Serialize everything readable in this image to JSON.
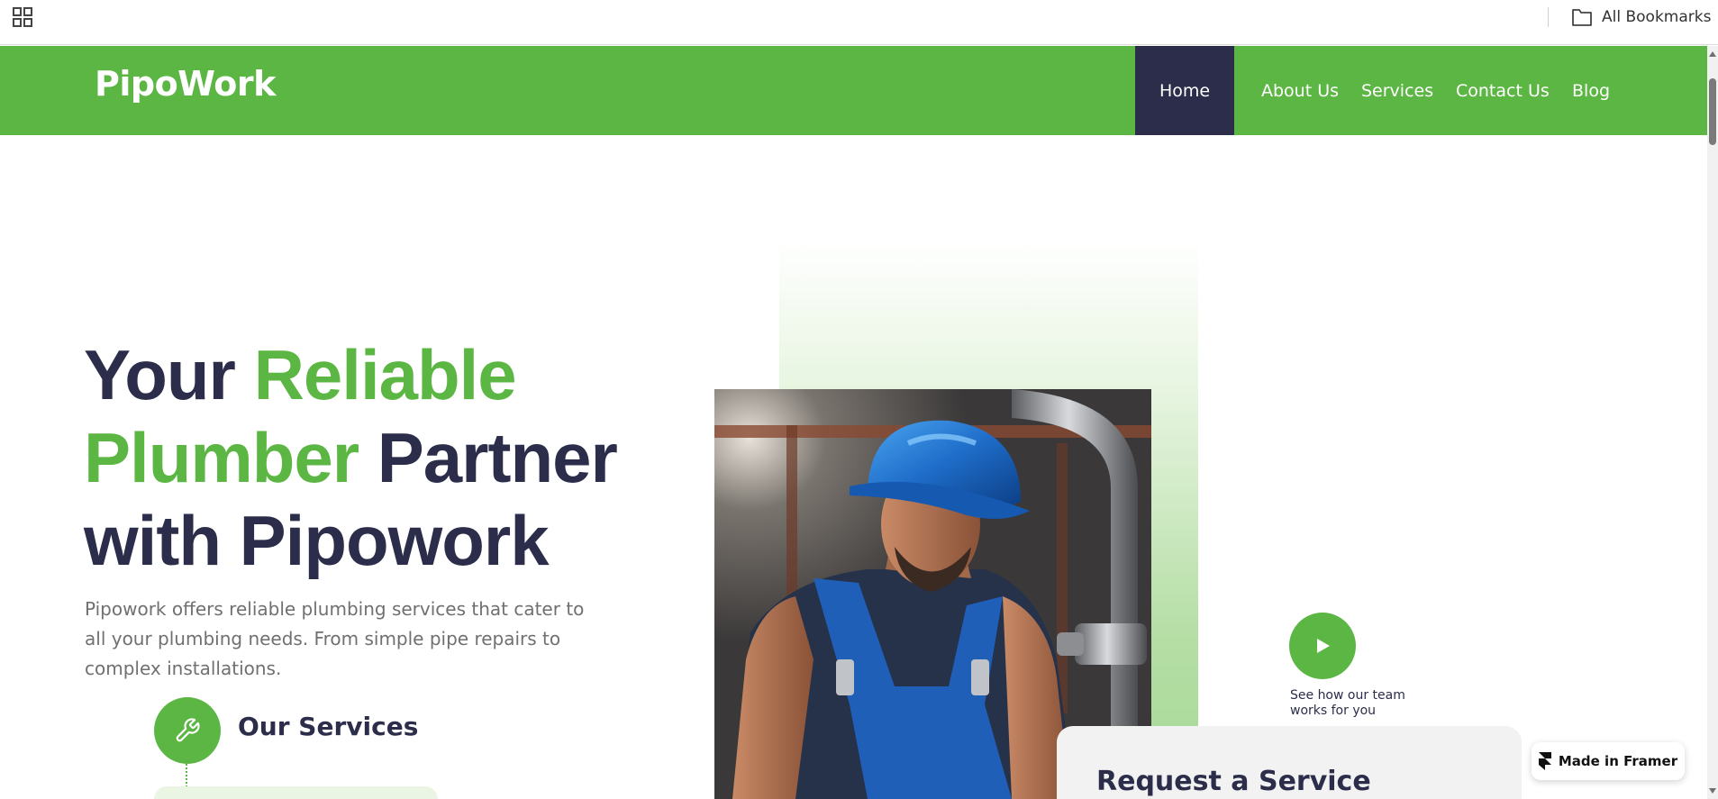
{
  "bookmarks_bar": {
    "apps_icon": "apps-grid-icon",
    "folder_icon": "folder-icon",
    "all_bookmarks_label": "All Bookmarks"
  },
  "nav": {
    "logo": "PipoWork",
    "items": [
      {
        "label": "Home",
        "active": true
      },
      {
        "label": "About Us"
      },
      {
        "label": "Services"
      },
      {
        "label": "Contact Us"
      },
      {
        "label": "Blog"
      }
    ]
  },
  "hero": {
    "title_part1": "Your ",
    "title_accent1": "Reliable",
    "title_accent2": "Plumber",
    "title_part2": " Partner",
    "title_part3": "with Pipowork",
    "description": "Pipowork offers reliable plumbing services that cater to all your plumbing needs. From simple pipe repairs to complex installations."
  },
  "services": {
    "icon": "wrench-icon",
    "title": "Our Services"
  },
  "video": {
    "icon": "play-icon",
    "caption": "See how our team works for you"
  },
  "request": {
    "title": "Request a Service"
  },
  "framer_badge": {
    "icon": "framer-icon",
    "label": "Made in Framer"
  },
  "colors": {
    "brand_green": "#5cb643",
    "navy": "#2b2d4a",
    "text_gray": "#707070"
  }
}
